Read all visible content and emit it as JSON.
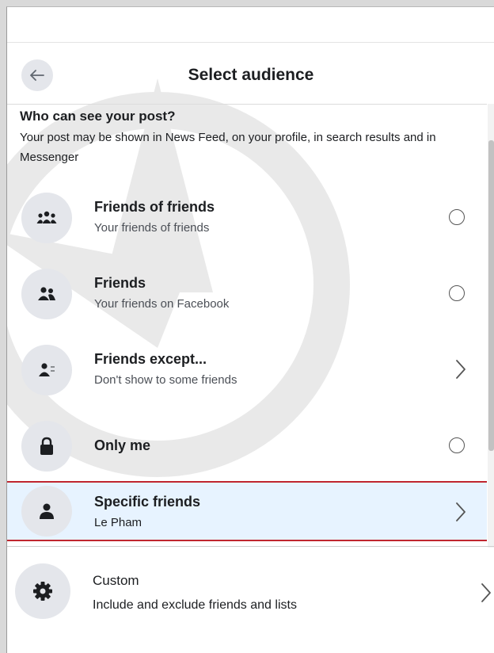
{
  "header": {
    "title": "Select audience"
  },
  "intro": {
    "heading": "Who can see your post?",
    "body": "Your post may be shown in News Feed, on your profile, in search results and in Messenger"
  },
  "options": [
    {
      "label": "Friends of friends",
      "sub": "Your friends of friends",
      "icon": "friends-of-friends-icon",
      "control": "radio"
    },
    {
      "label": "Friends",
      "sub": "Your friends on Facebook",
      "icon": "friends-icon",
      "control": "radio"
    },
    {
      "label": "Friends except...",
      "sub": "Don't show to some friends",
      "icon": "friends-except-icon",
      "control": "chevron"
    },
    {
      "label": "Only me",
      "sub": "",
      "icon": "lock-icon",
      "control": "radio"
    },
    {
      "label": "Specific friends",
      "sub": "Le Pham",
      "icon": "person-icon",
      "control": "chevron",
      "selected": true
    },
    {
      "label": "Custom",
      "sub": "Include and exclude friends and lists",
      "icon": "gear-icon",
      "control": "chevron"
    }
  ],
  "colors": {
    "icon_bg": "#e4e6eb",
    "selected_bg": "#e7f3ff",
    "selected_outline": "#c0262f",
    "text": "#1c1e21"
  }
}
